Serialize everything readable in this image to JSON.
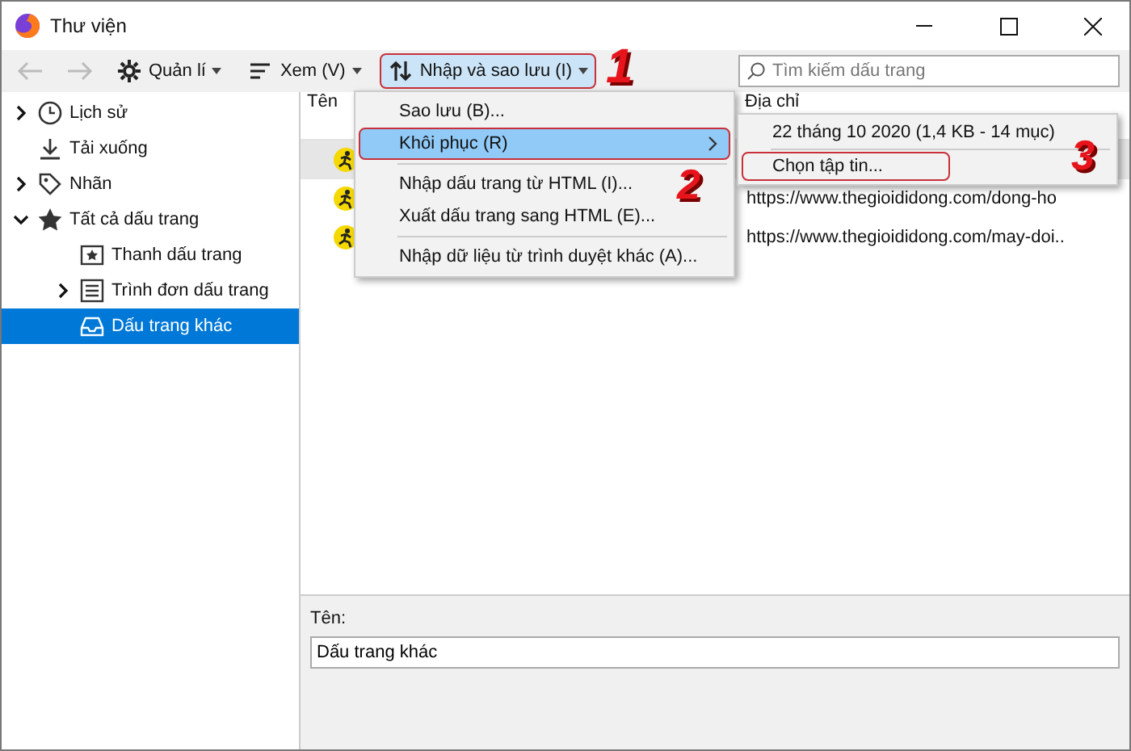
{
  "window": {
    "title": "Thư viện"
  },
  "toolbar": {
    "back": {
      "disabled": true
    },
    "forward": {
      "disabled": true
    },
    "menus": [
      {
        "kind": "gear",
        "label": "Quản lí",
        "selected": false
      },
      {
        "kind": "lines",
        "label": "Xem (V)",
        "selected": false
      },
      {
        "kind": "arrows",
        "label": "Nhập và sao lưu (I)",
        "selected": true
      }
    ],
    "search": {
      "placeholder": "Tìm kiếm dấu trang"
    }
  },
  "sidebar": {
    "items": [
      {
        "kind": "clock",
        "label": "Lịch sử",
        "expanded": false,
        "selected": false
      },
      {
        "kind": "download",
        "label": "Tải xuống",
        "selected": false
      },
      {
        "kind": "tag",
        "label": "Nhãn",
        "expanded": false,
        "selected": false
      },
      {
        "kind": "star",
        "label": "Tất cả dấu trang",
        "expanded": true,
        "selected": false,
        "children": [
          {
            "kind": "bar",
            "label": "Thanh dấu trang",
            "selected": false
          },
          {
            "kind": "list",
            "label": "Trình đơn dấu trang",
            "expanded": false,
            "selected": false
          },
          {
            "kind": "tray",
            "label": "Dấu trang khác",
            "selected": true
          }
        ]
      }
    ]
  },
  "table": {
    "columns": [
      "Tên",
      "Địa chỉ"
    ],
    "rows": [
      {
        "selected": true
      },
      {
        "selected": false,
        "url": "https://www.thegioididong.com/dong-ho"
      },
      {
        "selected": false,
        "url": "https://www.thegioididong.com/may-doi.."
      }
    ]
  },
  "details": {
    "name_label": "Tên:",
    "name_value": "Dấu trang khác"
  },
  "menu": {
    "items": [
      {
        "kind": "item",
        "label": "Sao lưu (B)...",
        "selected": false
      },
      {
        "kind": "submenu",
        "label": "Khôi phục (R)",
        "selected": true
      },
      {
        "kind": "separator"
      },
      {
        "kind": "item",
        "label": "Nhập dấu trang từ HTML (I)...",
        "selected": false
      },
      {
        "kind": "item",
        "label": "Xuất dấu trang sang HTML (E)...",
        "selected": false
      },
      {
        "kind": "separator"
      },
      {
        "kind": "item",
        "label": "Nhập dữ liệu từ trình duyệt khác (A)...",
        "selected": false
      }
    ]
  },
  "submenu": {
    "items": [
      {
        "kind": "item",
        "label": "22 tháng 10 2020 (1,4 KB - 14 mục)"
      },
      {
        "kind": "separator"
      },
      {
        "kind": "item",
        "label": "Chọn tập tin..."
      }
    ]
  },
  "annotations": [
    "1",
    "2",
    "3"
  ]
}
